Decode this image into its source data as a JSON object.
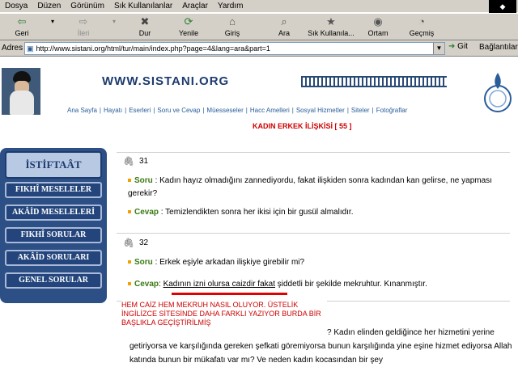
{
  "menubar": {
    "items": [
      "Dosya",
      "Düzen",
      "Görünüm",
      "Sık Kullanılanlar",
      "Araçlar",
      "Yardım"
    ]
  },
  "toolbar": {
    "buttons": [
      {
        "label": "Geri",
        "icon": "back-arrow-icon",
        "enabled": true
      },
      {
        "label": "İleri",
        "icon": "forward-arrow-icon",
        "enabled": false
      },
      {
        "label": "Dur",
        "icon": "stop-icon",
        "enabled": true
      },
      {
        "label": "Yenile",
        "icon": "refresh-icon",
        "enabled": true
      },
      {
        "label": "Giriş",
        "icon": "home-icon",
        "enabled": true
      },
      {
        "label": "Ara",
        "icon": "search-icon",
        "enabled": true
      },
      {
        "label": "Sık Kullanıla...",
        "icon": "favorites-icon",
        "enabled": true
      },
      {
        "label": "Ortam",
        "icon": "media-icon",
        "enabled": true
      },
      {
        "label": "Geçmiş",
        "icon": "history-icon",
        "enabled": true
      }
    ]
  },
  "address": {
    "label": "Adres",
    "url": "http://www.sistani.org/html/tur/main/index.php?page=4&lang=ara&part=1",
    "go_label": "Git",
    "links_label": "Bağlantılar"
  },
  "header": {
    "site_title": "WWW.SISTANI.ORG",
    "nav_items": [
      "Ana Sayfa",
      "Hayatı",
      "Eserleri",
      "Soru ve Cevap",
      "Müesseseler",
      "Hacc Amelleri",
      "Sosyal Hizmetler",
      "Siteler",
      "Fotoğraflar"
    ]
  },
  "headline": "KADIN ERKEK İLİŞKİSİ [ 55 ]",
  "sidebar": {
    "title": "İSTİFTAÂT",
    "buttons": [
      "FIKHÎ MESELELER",
      "AKÂİD MESELELERİ",
      "FIKHÎ SORULAR",
      "AKÂİD SORULARI",
      "GENEL SORULAR"
    ]
  },
  "qa": [
    {
      "number": "31",
      "q_label": "Soru",
      "question": ": Kadın hayız olmadığını zannediyordu, fakat ilişkiden sonra kadından kan gelirse, ne yapması gerekir?",
      "a_label": "Cevap",
      "answer": ": Temizlendikten sonra her ikisi için bir gusül almalıdır."
    },
    {
      "number": "32",
      "q_label": "Soru",
      "question": ": Erkek eşiyle arkadan ilişkiye girebilir mi?",
      "a_label": "Cevap",
      "answer_prefix": ": ",
      "answer_underlined": "Kadının izni olursa caizdir fakat",
      "answer_rest": " şiddetli bir şekilde mekruhtur. Kınanmıştır."
    }
  ],
  "annotation": "HEM CAİZ HEM MEKRUH NASIL OLUYOR. ÜSTELİK İNGİLİZCE SİTESİNDE DAHA FARKLI YAZIYOR BURDA BİR BAŞLIKLA GEÇİŞTİRİLMİŞ",
  "next_text": "? Kadın elinden geldiğince her hizmetini yerine getiriyorsa ve karşılığında gereken şefkati göremiyorsa bunun karşılığında yine eşine hizmet ediyorsa Allah katında bunun bir mükafatı var mı? Ve neden kadın kocasından bir şey",
  "colors": {
    "sidebar": "#2c4f85",
    "nav_link": "#2a5d9a",
    "answer_label": "#3a7a12",
    "annotation": "#cc0000",
    "underline_mark": "#e00000"
  }
}
